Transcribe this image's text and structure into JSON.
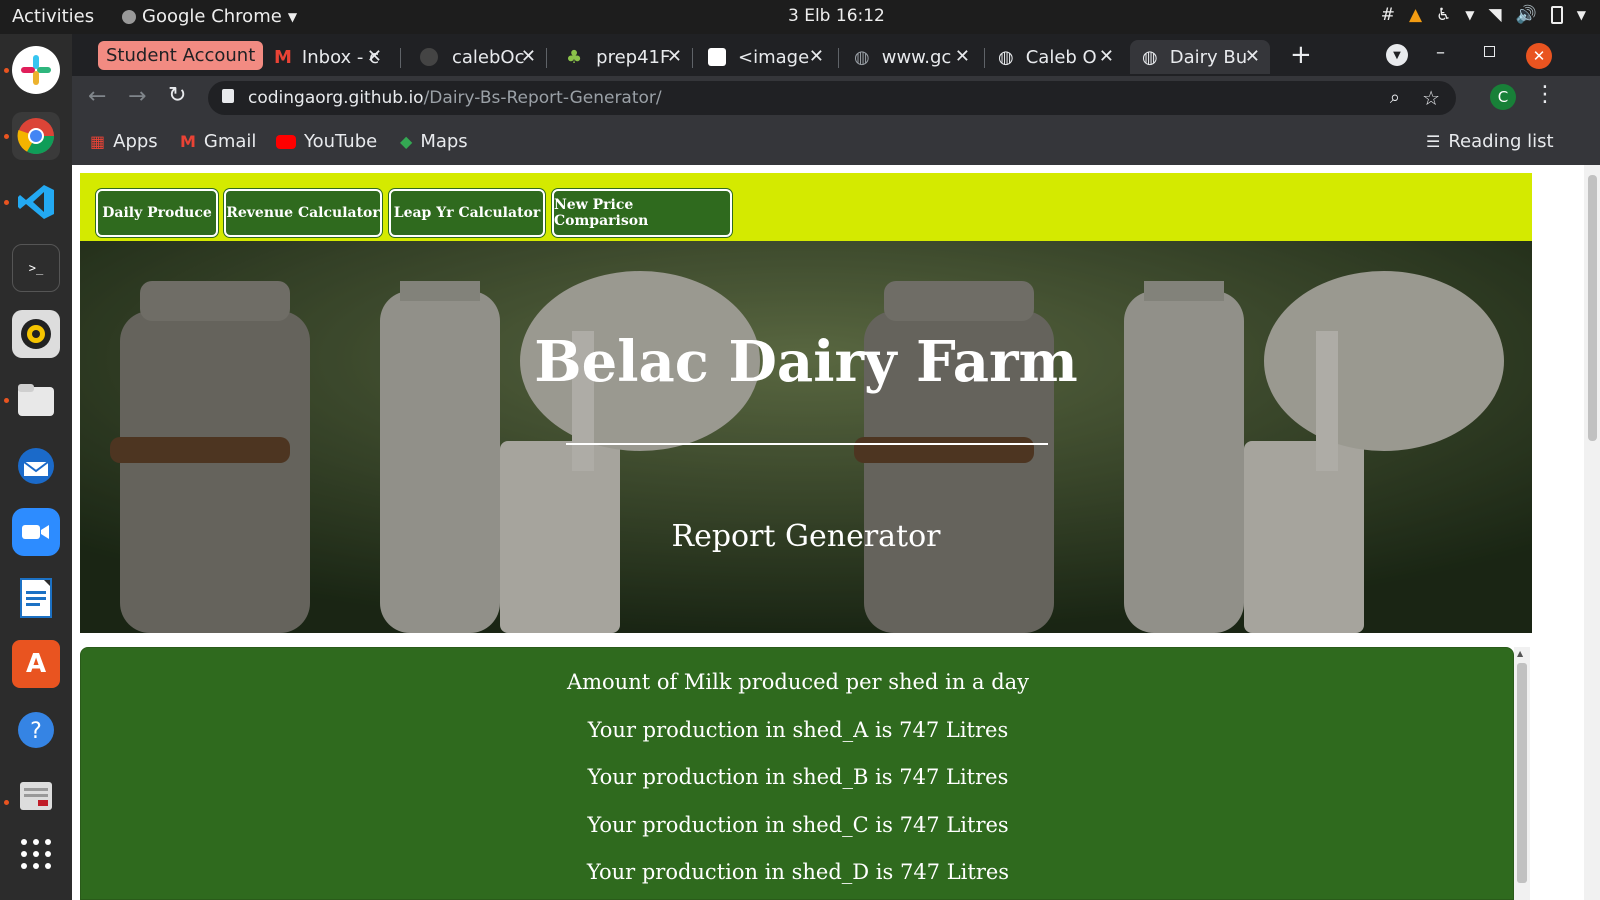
{
  "system": {
    "activities": "Activities",
    "app_menu": "Google Chrome",
    "clock": "3 Elb  16:12"
  },
  "chrome": {
    "student_account": "Student Account",
    "tabs": [
      {
        "label": "Inbox - c"
      },
      {
        "label": "calebOc"
      },
      {
        "label": "prep41F"
      },
      {
        "label": "<image"
      },
      {
        "label": "www.gc"
      },
      {
        "label": "Caleb O"
      },
      {
        "label": "Dairy Bu"
      }
    ],
    "address": {
      "host": "codingaorg.github.io",
      "path": "/Dairy-Bs-Report-Generator/"
    },
    "profile_initial": "C",
    "bookmarks": [
      "Apps",
      "Gmail",
      "YouTube",
      "Maps"
    ],
    "reading_list": "Reading list"
  },
  "page": {
    "nav_buttons": [
      "Daily Produce",
      "Revenue Calculator",
      "Leap Yr Calculator",
      "New Price Comparison"
    ],
    "title": "Belac Dairy Farm",
    "subtitle": "Report Generator",
    "report_lines": [
      "Amount of Milk produced per shed in a day",
      "Your production in shed_A is 747 Litres",
      "Your production in shed_B is 747 Litres",
      "Your production in shed_C is 747 Litres",
      "Your production in shed_D is 747 Litres"
    ]
  },
  "colors": {
    "navbar_bg": "#d4ea00",
    "button_green": "#2f6a1e",
    "report_green": "#2f6a1e"
  }
}
